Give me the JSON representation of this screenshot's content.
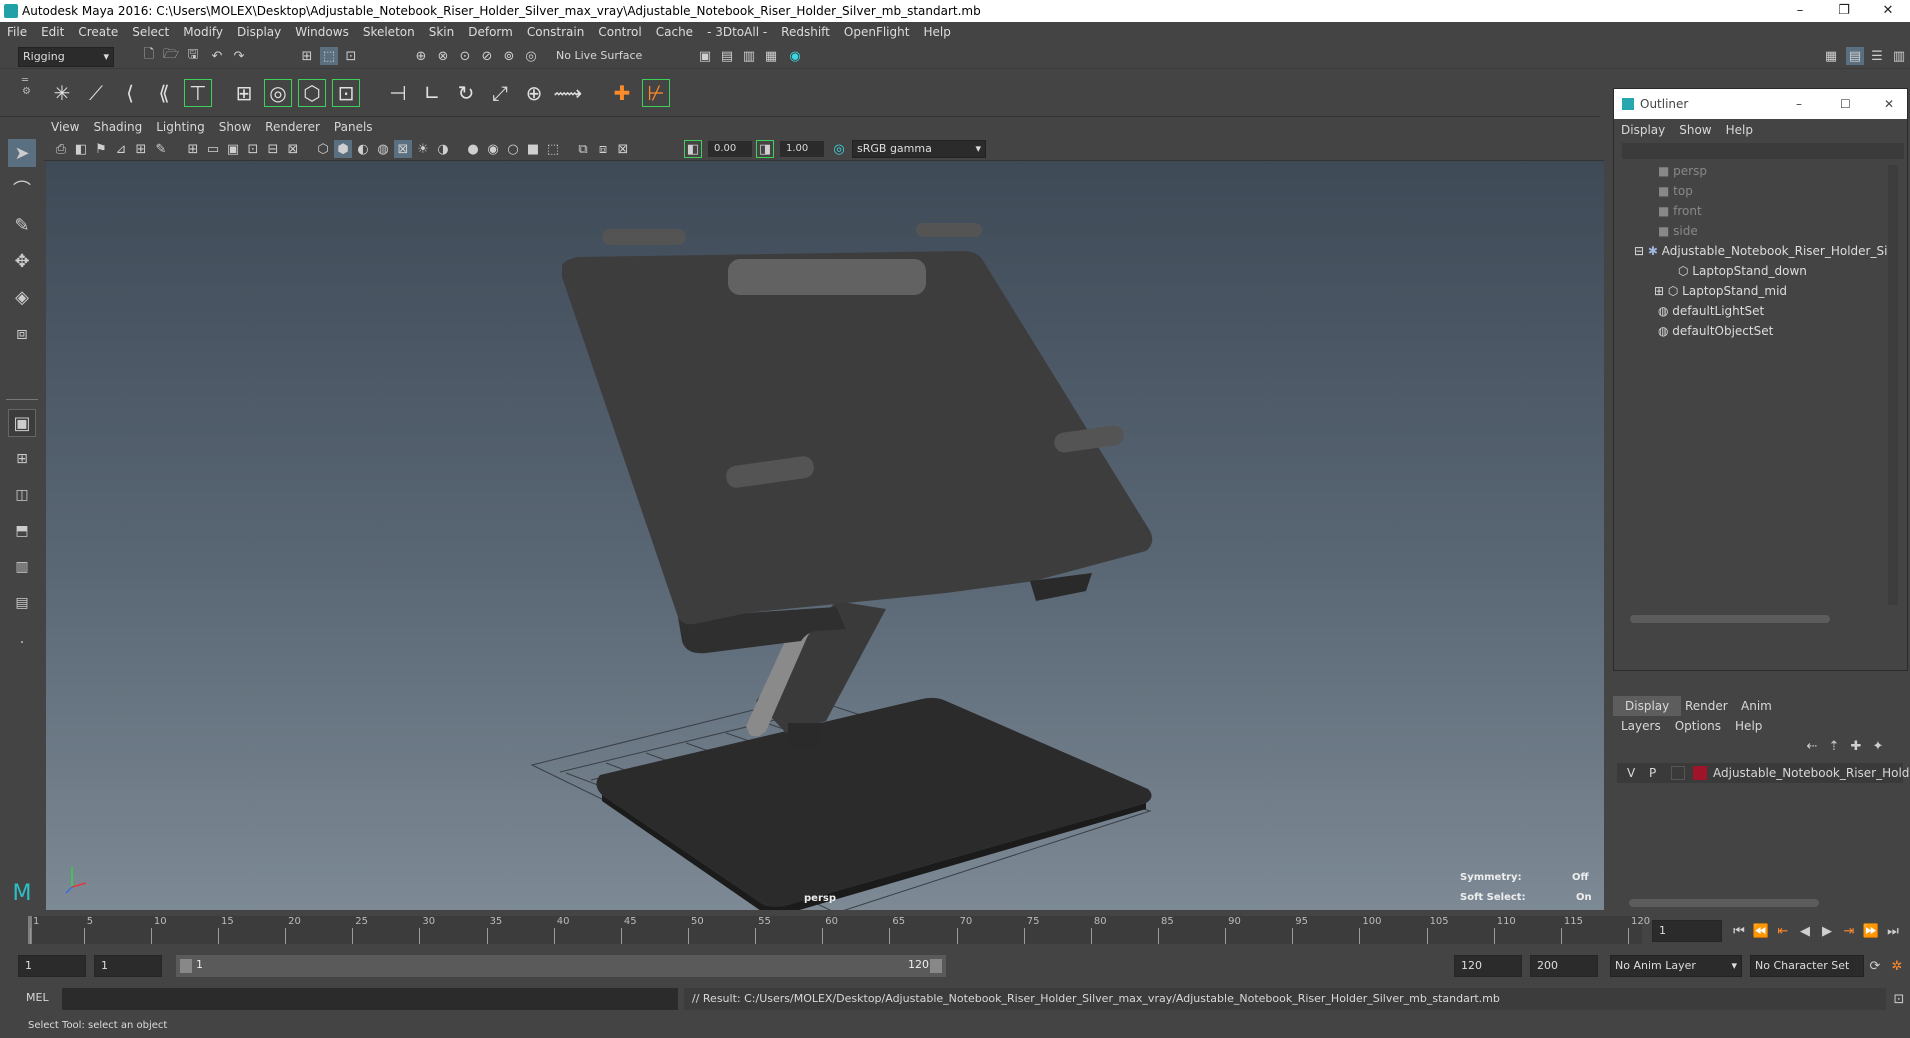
{
  "window": {
    "title": "Autodesk Maya 2016: C:\\Users\\MOLEX\\Desktop\\Adjustable_Notebook_Riser_Holder_Silver_max_vray\\Adjustable_Notebook_Riser_Holder_Silver_mb_standart.mb",
    "minimize": "–",
    "restore": "❐",
    "close": "✕"
  },
  "menubar": [
    "File",
    "Edit",
    "Create",
    "Select",
    "Modify",
    "Display",
    "Windows",
    "Skeleton",
    "Skin",
    "Deform",
    "Constrain",
    "Control",
    "Cache",
    "- 3DtoAll -",
    "Redshift",
    "OpenFlight",
    "Help"
  ],
  "statusline": {
    "menuset": "Rigging",
    "live_surface": "No Live Surface"
  },
  "panel": {
    "menus": [
      "View",
      "Shading",
      "Lighting",
      "Show",
      "Renderer",
      "Panels"
    ],
    "near_value": "0.00",
    "far_value": "1.00",
    "color_space": "sRGB gamma"
  },
  "viewport": {
    "camera_label": "persp",
    "symmetry_label": "Symmetry:",
    "symmetry_value": "Off",
    "soft_select_label": "Soft Select:",
    "soft_select_value": "On"
  },
  "outliner": {
    "title": "Outliner",
    "menus": [
      "Display",
      "Show",
      "Help"
    ],
    "items": [
      {
        "label": "persp",
        "dim": true
      },
      {
        "label": "top",
        "dim": true
      },
      {
        "label": "front",
        "dim": true
      },
      {
        "label": "side",
        "dim": true
      },
      {
        "label": "Adjustable_Notebook_Riser_Holder_Silv",
        "dim": false
      },
      {
        "label": "LaptopStand_down",
        "dim": false
      },
      {
        "label": "LaptopStand_mid",
        "dim": false
      },
      {
        "label": "defaultLightSet",
        "dim": false
      },
      {
        "label": "defaultObjectSet",
        "dim": false
      }
    ]
  },
  "layers": {
    "tabs": [
      "Display",
      "Render",
      "Anim"
    ],
    "menus": [
      "Layers",
      "Options",
      "Help"
    ],
    "row": {
      "v": "V",
      "p": "P",
      "name": "Adjustable_Notebook_Riser_Holder",
      "color": "#a0142a"
    }
  },
  "timeline": {
    "ticks": [
      "1",
      "5",
      "10",
      "15",
      "20",
      "25",
      "30",
      "35",
      "40",
      "45",
      "50",
      "55",
      "60",
      "65",
      "70",
      "75",
      "80",
      "85",
      "90",
      "95",
      "100",
      "105",
      "110",
      "115",
      "120"
    ],
    "current_frame": "1"
  },
  "range": {
    "start": "1",
    "anim_start": "1",
    "slider_start": "1",
    "slider_end": "120",
    "anim_end": "120",
    "end": "200",
    "anim_layer": "No Anim Layer",
    "char_set": "No Character Set"
  },
  "cmdline": {
    "lang": "MEL",
    "result": "// Result: C:/Users/MOLEX/Desktop/Adjustable_Notebook_Riser_Holder_Silver_max_vray/Adjustable_Notebook_Riser_Holder_Silver_mb_standart.mb"
  },
  "helpline": "Select Tool: select an object"
}
